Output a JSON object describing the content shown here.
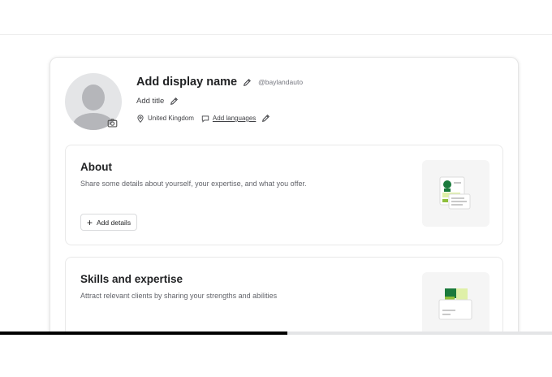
{
  "profile": {
    "display_name": "Add display name",
    "username": "@baylandauto",
    "title_placeholder": "Add title",
    "location": "United Kingdom",
    "languages_link": "Add languages"
  },
  "sections": {
    "about": {
      "title": "About",
      "description": "Share some details about yourself, your expertise, and what you offer.",
      "button": "Add details"
    },
    "skills": {
      "title": "Skills and expertise",
      "description": "Attract relevant clients by sharing your strengths and abilities"
    }
  },
  "progress": {
    "fraction": 0.52
  },
  "icons": [
    "camera-icon",
    "pencil-icon",
    "location-pin-icon",
    "speech-bubble-icon",
    "plus-icon"
  ],
  "colors": {
    "accent_green": "#1dbf73",
    "progress": "#000000"
  }
}
